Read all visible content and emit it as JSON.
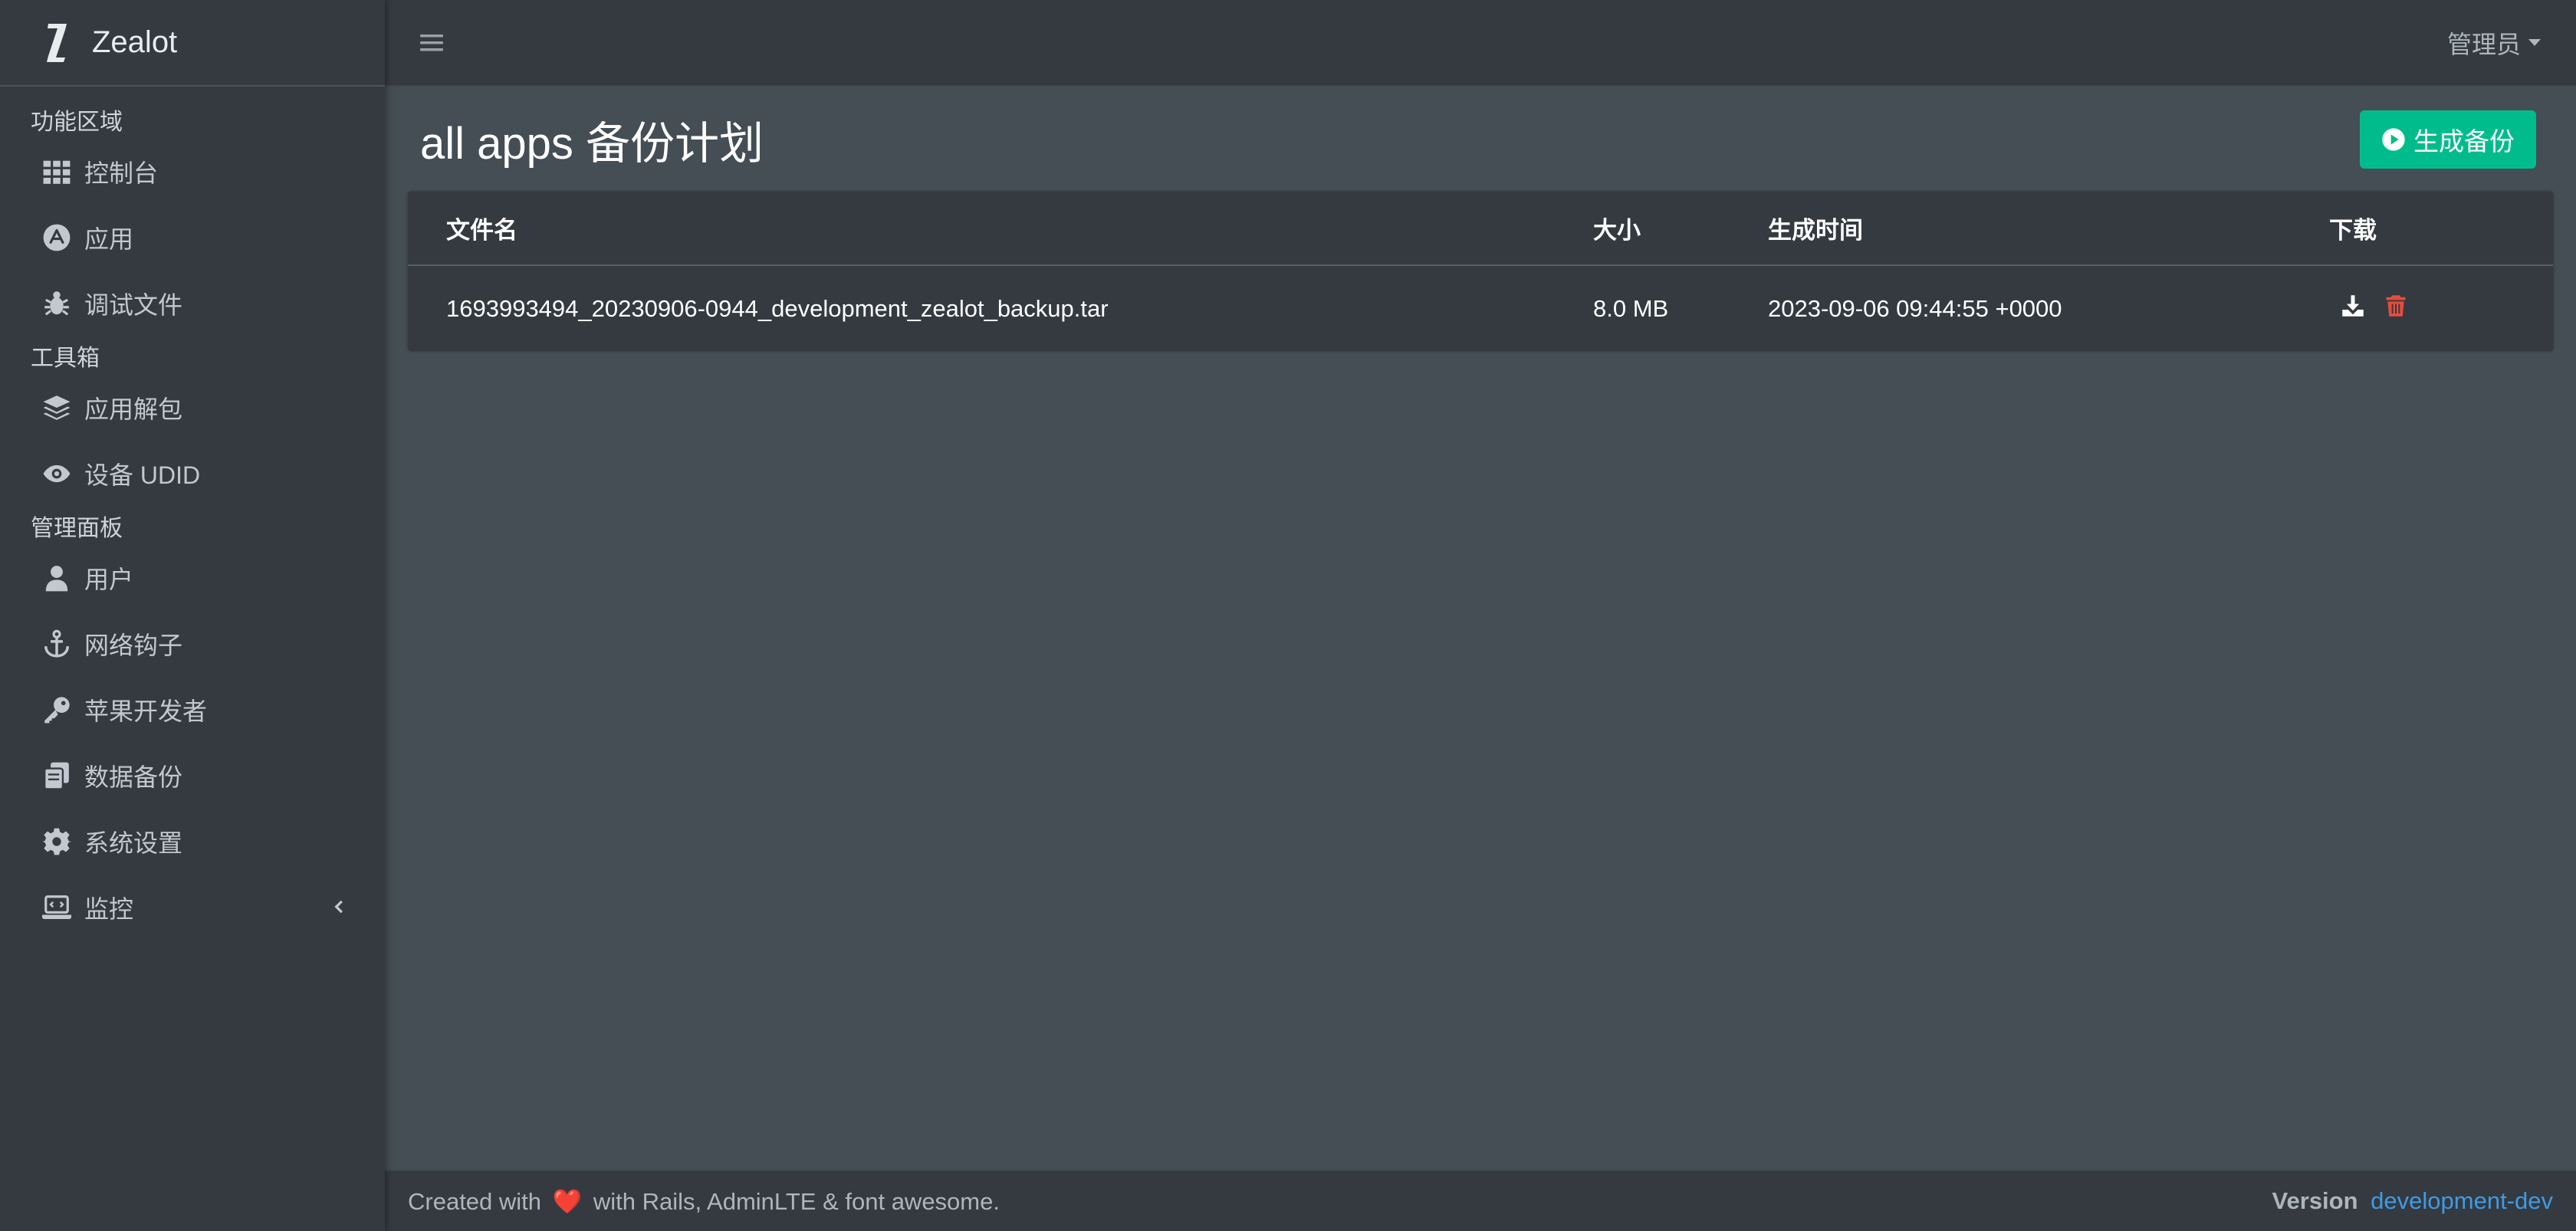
{
  "brand": {
    "name": "Zealot",
    "logo_letter": "Z"
  },
  "topbar": {
    "user_label": "管理员"
  },
  "sidebar": {
    "sections": [
      {
        "header": "功能区域",
        "items": [
          {
            "label": "控制台",
            "icon": "th-icon"
          },
          {
            "label": "应用",
            "icon": "app-store-icon"
          },
          {
            "label": "调试文件",
            "icon": "bug-icon"
          }
        ]
      },
      {
        "header": "工具箱",
        "items": [
          {
            "label": "应用解包",
            "icon": "layers-icon"
          },
          {
            "label": "设备 UDID",
            "icon": "eye-icon"
          }
        ]
      },
      {
        "header": "管理面板",
        "items": [
          {
            "label": "用户",
            "icon": "user-icon"
          },
          {
            "label": "网络钩子",
            "icon": "anchor-icon"
          },
          {
            "label": "苹果开发者",
            "icon": "key-icon"
          },
          {
            "label": "数据备份",
            "icon": "copy-icon"
          },
          {
            "label": "系统设置",
            "icon": "gear-icon"
          },
          {
            "label": "监控",
            "icon": "laptop-code-icon",
            "has_caret": true
          }
        ]
      }
    ]
  },
  "page": {
    "title": "all apps 备份计划",
    "generate_button": "生成备份"
  },
  "table": {
    "headers": [
      "文件名",
      "大小",
      "生成时间",
      "下载"
    ],
    "rows": [
      {
        "filename": "1693993494_20230906-0944_development_zealot_backup.tar",
        "size": "8.0 MB",
        "created_at": "2023-09-06 09:44:55 +0000"
      }
    ]
  },
  "footer": {
    "created_prefix": "Created with",
    "heart": "❤️",
    "created_suffix": "with Rails, AdminLTE & font awesome.",
    "version_label": "Version",
    "version_value": "development-dev"
  },
  "colors": {
    "sidebar_bg": "#343a40",
    "content_bg": "#454d55",
    "accent_green": "#00bc8c",
    "danger_red": "#e74c3c",
    "link_blue": "#3f9ae5"
  }
}
